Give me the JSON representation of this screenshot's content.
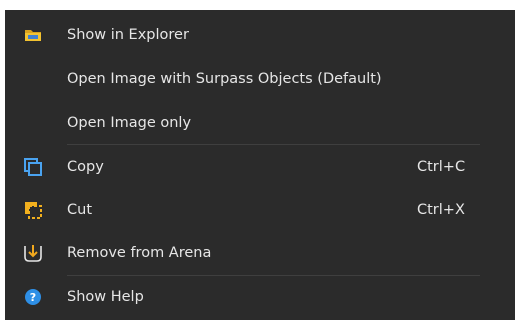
{
  "menu": {
    "items": [
      {
        "label": "Show in Explorer",
        "icon": "folder-icon"
      },
      {
        "label": "Open Image with Surpass Objects (Default)"
      },
      {
        "label": "Open Image only"
      },
      {
        "label": "Copy",
        "icon": "copy-icon",
        "shortcut": "Ctrl+C"
      },
      {
        "label": "Cut",
        "icon": "cut-icon",
        "shortcut": "Ctrl+X"
      },
      {
        "label": "Remove from Arena",
        "icon": "remove-from-arena-icon"
      },
      {
        "label": "Show Help",
        "icon": "help-icon"
      }
    ]
  },
  "colors": {
    "menu_background": "#2b2b2b",
    "text": "#e6e6e6",
    "separator": "#3f3f3f",
    "folder": "#f2c230",
    "copy_icon": "#4aa3f0",
    "cut_icon": "#f2b01e",
    "remove_arrow": "#f2a91e",
    "help_icon": "#2e8fe6"
  }
}
